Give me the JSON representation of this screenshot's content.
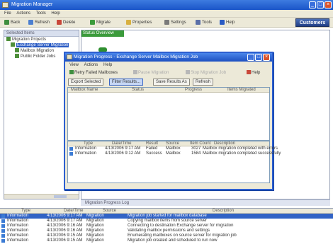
{
  "main_window": {
    "title": "Migration Manager",
    "menu": [
      "File",
      "Actions",
      "Tools",
      "Help"
    ],
    "toolbar": [
      "Back",
      "Refresh",
      "Delete",
      "Migrate",
      "Properties",
      "Settings",
      "Tools",
      "Help"
    ],
    "customer_button": "Customers"
  },
  "left_pane": {
    "header": "Selected Items",
    "tree": [
      {
        "label": "Migration Projects",
        "depth": 0,
        "selected": false
      },
      {
        "label": "Exchange Server Migration",
        "depth": 1,
        "selected": true
      },
      {
        "label": "Mailbox Migration",
        "depth": 2,
        "selected": false
      },
      {
        "label": "Public Folder Jobs",
        "depth": 2,
        "selected": false
      }
    ]
  },
  "right_pane": {
    "header": "Status Overview",
    "footer": "Migration Progress Log"
  },
  "dialog": {
    "title": "Migration Progress - Exchange Server Mailbox Migration Job",
    "menu": [
      "View",
      "Actions",
      "Help"
    ],
    "toolbar": [
      {
        "label": "Retry Failed Mailboxes",
        "dim": false
      },
      {
        "label": "Pause Migration",
        "dim": true
      },
      {
        "label": "Stop Migration Job",
        "dim": true
      },
      {
        "label": "Help",
        "dim": false
      }
    ],
    "actions": [
      "Export Selected",
      "Filter Results...",
      "Save Results As",
      "Refresh"
    ],
    "top_columns": [
      "Mailbox Name",
      "Status",
      "Progress",
      "Items Migrated"
    ],
    "bottom_columns": [
      "Type",
      "Date/Time",
      "Result",
      "Source",
      "Item Count",
      "Description"
    ],
    "bottom_rows": [
      {
        "type": "Information",
        "datetime": "4/13/2006 9:17 AM",
        "result": "Failed",
        "source": "Mailbox",
        "count": "3027",
        "description": "Mailbox migration completed with errors"
      },
      {
        "type": "Information",
        "datetime": "4/13/2006 9:12 AM",
        "result": "Success",
        "source": "Mailbox",
        "count": "1584",
        "description": "Mailbox migration completed successfully"
      }
    ]
  },
  "log": {
    "columns": [
      "Type",
      "Date/Time",
      "Source",
      "Description"
    ],
    "rows": [
      {
        "type": "Information",
        "datetime": "4/13/2006 9:17 AM",
        "source": "Migration",
        "description": "Migration job started for mailbox database",
        "selected": true
      },
      {
        "type": "Information",
        "datetime": "4/13/2006 9:17 AM",
        "source": "Migration",
        "description": "Copying mailbox items from source server",
        "selected": false
      },
      {
        "type": "Information",
        "datetime": "4/13/2006 9:16 AM",
        "source": "Migration",
        "description": "Connecting to destination Exchange server for migration",
        "selected": false
      },
      {
        "type": "Information",
        "datetime": "4/13/2006 9:16 AM",
        "source": "Migration",
        "description": "Validating mailbox permissions and settings",
        "selected": false
      },
      {
        "type": "Information",
        "datetime": "4/13/2006 9:15 AM",
        "source": "Migration",
        "description": "Enumerating mailboxes on source server for migration job",
        "selected": false
      },
      {
        "type": "Information",
        "datetime": "4/13/2006 9:15 AM",
        "source": "Migration",
        "description": "Migration job created and scheduled to run now",
        "selected": false
      }
    ]
  }
}
